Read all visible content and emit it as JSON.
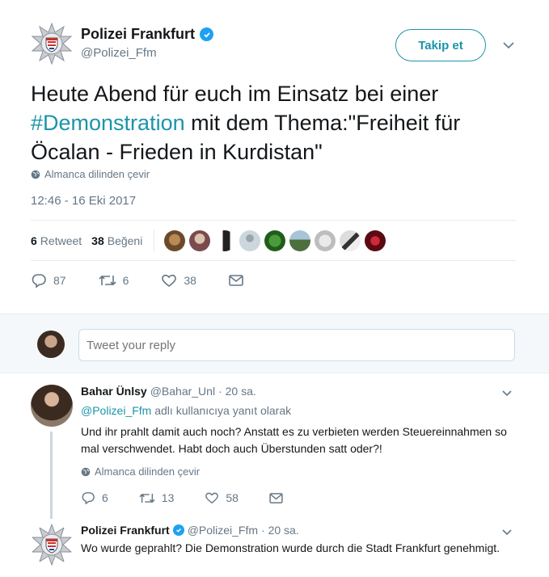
{
  "tweet": {
    "author_name": "Polizei Frankfurt",
    "author_handle": "@Polizei_Ffm",
    "follow_label": "Takip et",
    "text_before": "Heute Abend für euch im Einsatz bei einer ",
    "hashtag": "#Demonstration",
    "text_after": " mit dem Thema:\"Freiheit für Öcalan - Frieden in Kurdistan\"",
    "translate_label": "Almanca dilinden çevir",
    "timestamp": "12:46 - 16 Eki 2017",
    "retweets_count": "6",
    "retweets_label": "Retweet",
    "likes_count": "38",
    "likes_label": "Beğeni",
    "reply_count": "87",
    "retweet_count_action": "6",
    "like_count_action": "38"
  },
  "reply_box": {
    "placeholder": "Tweet your reply"
  },
  "replies": [
    {
      "name": "Bahar Ünlsy",
      "handle": "@Bahar_Unl",
      "time": "· 20 sa.",
      "replying_to_handle": "@Polizei_Ffm",
      "replying_to_suffix": "adlı kullanıcıya yanıt olarak",
      "text": "Und ihr prahlt damit auch noch? Anstatt es zu verbieten werden Steuereinnahmen so mal verschwendet. Habt doch auch Überstunden satt oder?!",
      "translate_label": "Almanca dilinden çevir",
      "reply_count": "6",
      "retweet_count": "13",
      "like_count": "58"
    },
    {
      "name": "Polizei Frankfurt",
      "handle": "@Polizei_Ffm",
      "time": "· 20 sa.",
      "text": "Wo wurde geprahlt? Die Demonstration wurde durch die Stadt Frankfurt genehmigt."
    }
  ],
  "colors": {
    "accent": "#1b95a8",
    "verified": "#1da1f2",
    "muted": "#657786",
    "reply_bg": "#f5f8fa"
  }
}
